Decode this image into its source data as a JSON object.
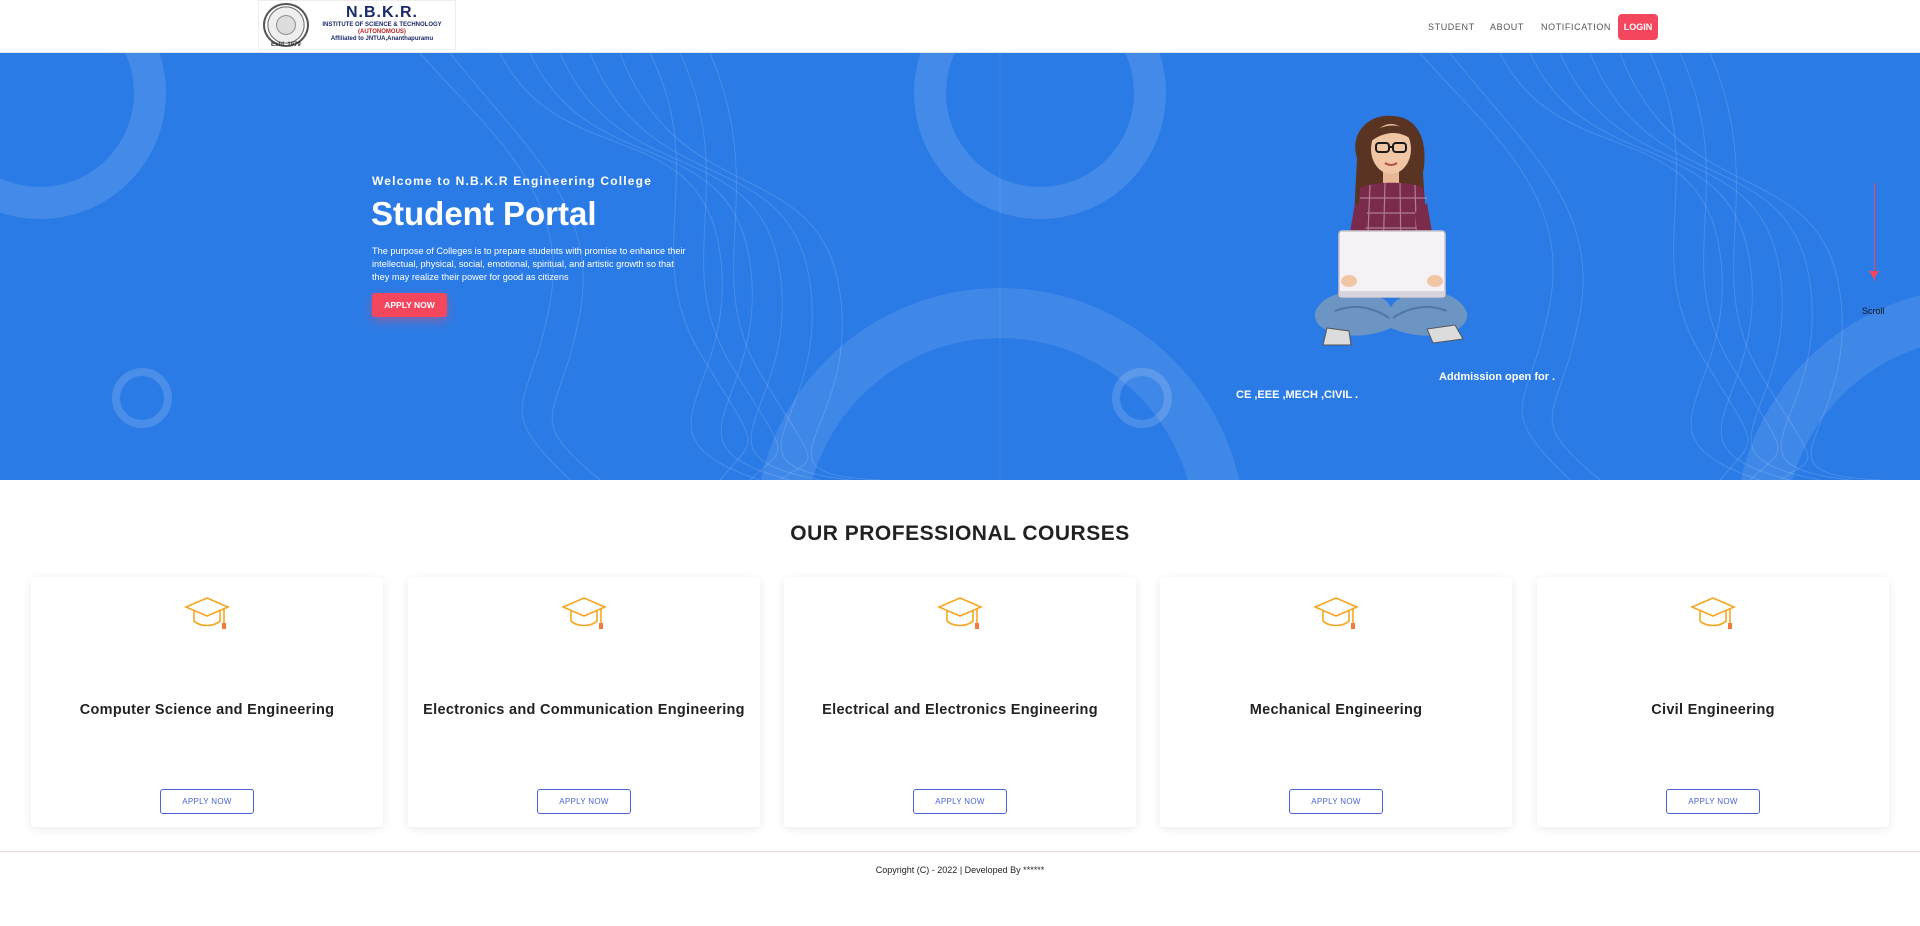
{
  "logo": {
    "name": "N.B.K.R.",
    "institute": "INSTITUTE OF SCIENCE & TECHNOLOGY",
    "autonomous": "(AUTONOMOUS)",
    "affiliation": "Affiliated to JNTUA,Ananthapuramu",
    "estd": "Estd. 1979"
  },
  "nav": {
    "student": "STUDENT",
    "about": "ABOUT",
    "notification": "NOTIFICATION",
    "login": "LOGIN"
  },
  "hero": {
    "welcome": "Welcome to N.B.K.R Engineering College",
    "title": "Student Portal",
    "description": "The purpose of Colleges is to prepare students with promise to enhance their intellectual, physical, social, emotional, spiritual, and artistic growth so that they may realize their power for good as citizens",
    "apply": "APPLY NOW",
    "admission": "Addmission open for .",
    "ticker": "CE ,EEE ,MECH ,CIVIL .",
    "scroll": "Scroll"
  },
  "courses": {
    "title": "OUR PROFESSIONAL COURSES",
    "items": [
      {
        "name": "Computer Science and Engineering",
        "button": "APPLY NOW",
        "icon": "graduation-cap-icon"
      },
      {
        "name": "Electronics and Communication Engineering",
        "button": "APPLY NOW",
        "icon": "graduation-cap-icon"
      },
      {
        "name": "Electrical and Electronics Engineering",
        "button": "APPLY NOW",
        "icon": "graduation-cap-icon"
      },
      {
        "name": "Mechanical Engineering",
        "button": "APPLY NOW",
        "icon": "graduation-cap-icon"
      },
      {
        "name": "Civil Engineering",
        "button": "APPLY NOW",
        "icon": "graduation-cap-icon"
      }
    ]
  },
  "footer": {
    "text": "Copyright (C) - 2022 | Developed By ******"
  },
  "colors": {
    "hero_bg": "#2b7be6",
    "accent_red": "#f4475d",
    "button_blue": "#4a63d8",
    "cap_orange": "#f5a623"
  }
}
